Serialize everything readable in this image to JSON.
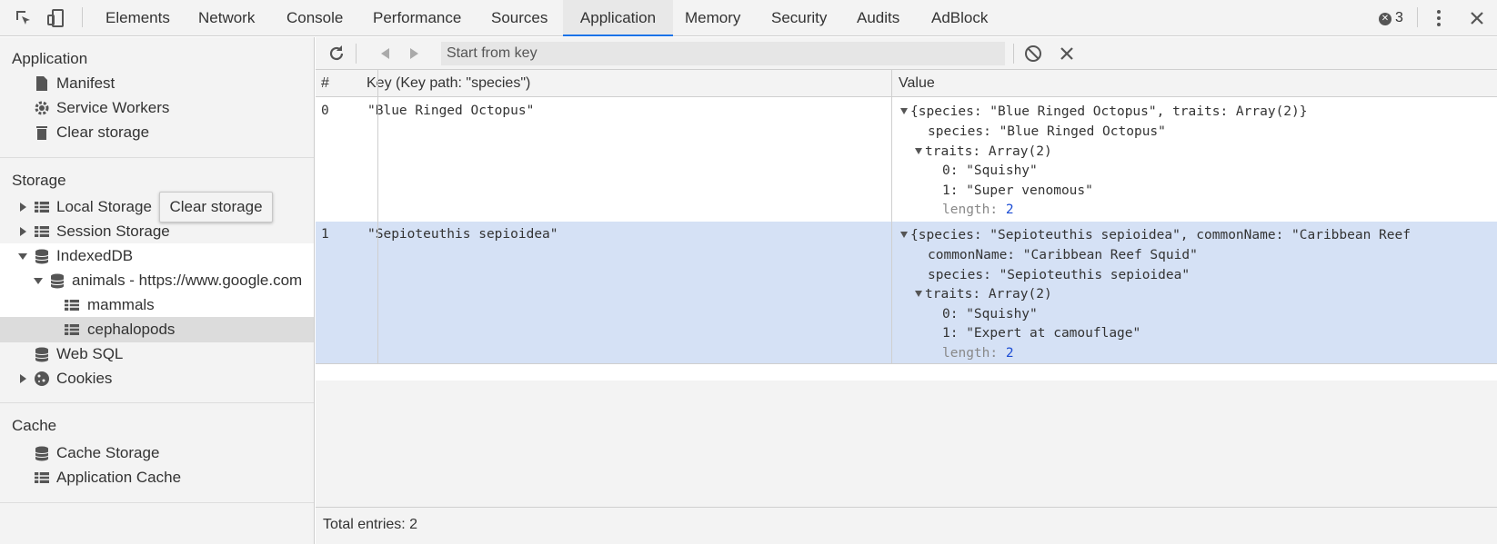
{
  "toolbar": {
    "tabs": [
      "Elements",
      "Network",
      "Console",
      "Performance",
      "Sources",
      "Application",
      "Memory",
      "Security",
      "Audits",
      "AdBlock"
    ],
    "active_tab": "Application",
    "error_count": "3",
    "accent": "#1a73e8"
  },
  "sidebar": {
    "application_title": "Application",
    "application_items": [
      "Manifest",
      "Service Workers",
      "Clear storage"
    ],
    "tooltip": "Clear storage",
    "storage_title": "Storage",
    "storage_items": [
      "Local Storage",
      "Session Storage",
      "IndexedDB",
      "animals - https://www.google.com",
      "mammals",
      "cephalopods",
      "Web SQL",
      "Cookies"
    ],
    "cache_title": "Cache",
    "cache_items": [
      "Cache Storage",
      "Application Cache"
    ]
  },
  "controls": {
    "key_placeholder": "Start from key"
  },
  "table": {
    "headers": [
      "#",
      "Key (Key path: \"species\")",
      "Value"
    ],
    "rows": [
      {
        "index": "0",
        "key": "\"Blue Ringed Octopus\"",
        "value_lines": [
          "{species: \"Blue Ringed Octopus\", traits: Array(2)}",
          "species: \"Blue Ringed Octopus\"",
          "traits: Array(2)",
          "0: \"Squishy\"",
          "1: \"Super venomous\"",
          "length: ",
          "2"
        ]
      },
      {
        "index": "1",
        "key": "\"Sepioteuthis sepioidea\"",
        "value_lines": [
          "{species: \"Sepioteuthis sepioidea\", commonName: \"Caribbean Reef",
          "commonName: \"Caribbean Reef Squid\"",
          "species: \"Sepioteuthis sepioidea\"",
          "traits: Array(2)",
          "0: \"Squishy\"",
          "1: \"Expert at camouflage\"",
          "length: ",
          "2"
        ]
      }
    ]
  },
  "status": {
    "total_entries": "Total entries: 2"
  }
}
